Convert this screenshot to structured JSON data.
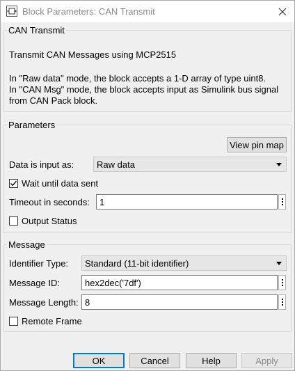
{
  "window": {
    "title": "Block Parameters: CAN Transmit",
    "icons": {
      "app": "block-icon",
      "close": "close-icon"
    }
  },
  "description": {
    "legend": "CAN Transmit",
    "summary": "Transmit CAN Messages using MCP2515",
    "lines": [
      "In \"Raw data\" mode, the block accepts a 1-D array of type uint8.",
      "In \"CAN Msg\" mode, the block accepts input as Simulink bus signal",
      "from CAN Pack block."
    ]
  },
  "parameters": {
    "legend": "Parameters",
    "view_pin_map": "View pin map",
    "data_input_label": "Data is input as:",
    "data_input_value": "Raw data",
    "wait_label": "Wait until data sent",
    "wait_checked": true,
    "timeout_label": "Timeout in seconds:",
    "timeout_value": "1",
    "output_status_label": "Output Status",
    "output_status_checked": false
  },
  "message": {
    "legend": "Message",
    "identifier_type_label": "Identifier Type:",
    "identifier_type_value": "Standard (11-bit identifier)",
    "message_id_label": "Message ID:",
    "message_id_value": "hex2dec('7df')",
    "message_length_label": "Message Length:",
    "message_length_value": "8",
    "remote_frame_label": "Remote Frame",
    "remote_frame_checked": false
  },
  "buttons": {
    "ok": "OK",
    "cancel": "Cancel",
    "help": "Help",
    "apply": "Apply"
  },
  "colors": {
    "default_button_border": "#0078d7",
    "background": "#f0f0f0"
  }
}
